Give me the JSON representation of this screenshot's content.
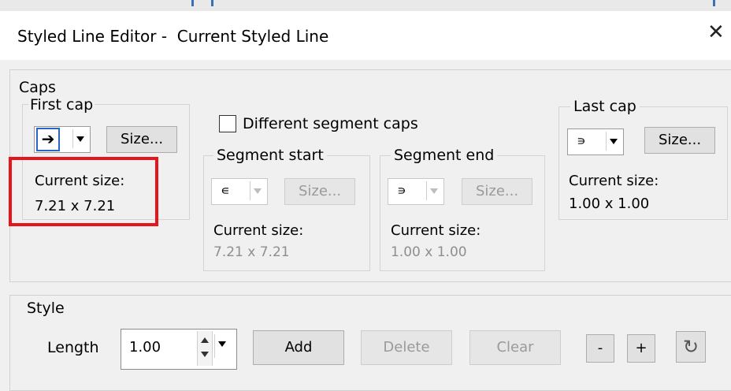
{
  "window": {
    "title": "Styled Line Editor -  Current Styled Line",
    "close_glyph": "✕"
  },
  "caps": {
    "group_label": "Caps",
    "first_cap": {
      "label": "First cap",
      "size_button": "Size...",
      "current_size_label": "Current size:",
      "current_size_value": "7.21 x 7.21",
      "glyph": "➔",
      "highlighted": true
    },
    "different_segment_caps": {
      "label": "Different segment caps",
      "checked": false
    },
    "segment_start": {
      "label": "Segment start",
      "size_button": "Size...",
      "current_size_label": "Current size:",
      "current_size_value": "7.21 x 7.21",
      "glyph": "∊",
      "enabled": false
    },
    "segment_end": {
      "label": "Segment end",
      "size_button": "Size...",
      "current_size_label": "Current size:",
      "current_size_value": "1.00 x 1.00",
      "glyph": "∍",
      "enabled": false
    },
    "last_cap": {
      "label": "Last cap",
      "size_button": "Size...",
      "current_size_label": "Current size:",
      "current_size_value": "1.00 x 1.00",
      "glyph": "∍"
    }
  },
  "style": {
    "group_label": "Style",
    "length_label": "Length",
    "length_value": "1.00",
    "buttons": {
      "add": "Add",
      "delete": "Delete",
      "clear": "Clear",
      "minus": "-",
      "plus": "+"
    },
    "reset_icon": "↻"
  },
  "colors": {
    "highlight_box": "#e5151b",
    "selected_combo": "#2a64c8"
  }
}
